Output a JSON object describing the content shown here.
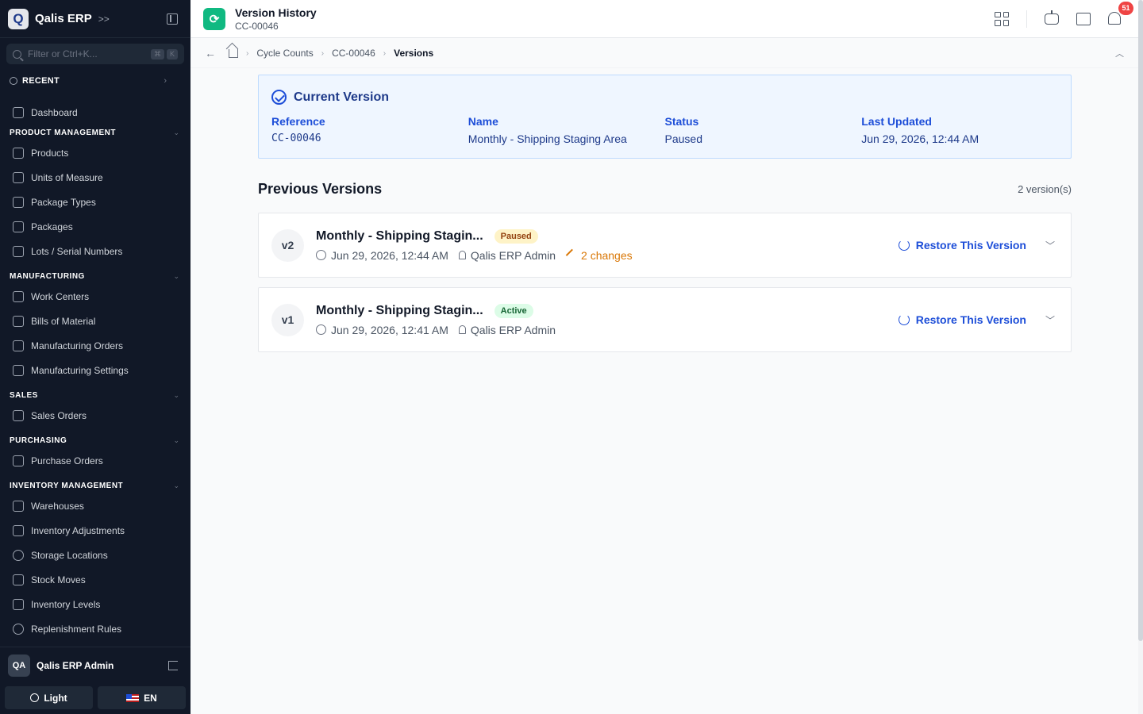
{
  "sidebar": {
    "logo_letter": "Q",
    "app_name": "Qalis ERP",
    "search_placeholder": "Filter or Ctrl+K...",
    "kbd": [
      "⌘",
      "K"
    ],
    "recent_label": "RECENT",
    "dashboard": "Dashboard",
    "sections": [
      {
        "label": "PRODUCT MANAGEMENT",
        "items": [
          "Products",
          "Units of Measure",
          "Package Types",
          "Packages",
          "Lots / Serial Numbers"
        ]
      },
      {
        "label": "MANUFACTURING",
        "items": [
          "Work Centers",
          "Bills of Material",
          "Manufacturing Orders",
          "Manufacturing Settings"
        ]
      },
      {
        "label": "SALES",
        "items": [
          "Sales Orders"
        ]
      },
      {
        "label": "PURCHASING",
        "items": [
          "Purchase Orders"
        ]
      },
      {
        "label": "INVENTORY MANAGEMENT",
        "items": [
          "Warehouses",
          "Inventory Adjustments",
          "Storage Locations",
          "Stock Moves",
          "Inventory Levels",
          "Replenishment Rules"
        ]
      }
    ],
    "user_initials": "QA",
    "user_name": "Qalis ERP Admin",
    "theme_label": "Light",
    "lang_label": "EN"
  },
  "header": {
    "title": "Version History",
    "subtitle": "CC-00046",
    "notification_count": "51"
  },
  "breadcrumb": [
    "Cycle Counts",
    "CC-00046",
    "Versions"
  ],
  "current_version": {
    "title": "Current Version",
    "fields": [
      {
        "label": "Reference",
        "value": "CC-00046"
      },
      {
        "label": "Name",
        "value": "Monthly - Shipping Staging Area"
      },
      {
        "label": "Status",
        "value": "Paused"
      },
      {
        "label": "Last Updated",
        "value": "Jun 29, 2026, 12:44 AM"
      }
    ]
  },
  "previous_versions": {
    "title": "Previous Versions",
    "count_label": "2 version(s)",
    "restore_label": "Restore This Version",
    "items": [
      {
        "version": "v2",
        "name": "Monthly - Shipping Stagin...",
        "status": "Paused",
        "date": "Jun 29, 2026, 12:44 AM",
        "user": "Qalis ERP Admin",
        "changes": "2 changes"
      },
      {
        "version": "v1",
        "name": "Monthly - Shipping Stagin...",
        "status": "Active",
        "date": "Jun 29, 2026, 12:41 AM",
        "user": "Qalis ERP Admin"
      }
    ]
  },
  "colors": {
    "accent": "#1d4ed8",
    "sidebar_bg": "#111827",
    "page_icon": "#10b981",
    "badge": "#ef4444"
  }
}
